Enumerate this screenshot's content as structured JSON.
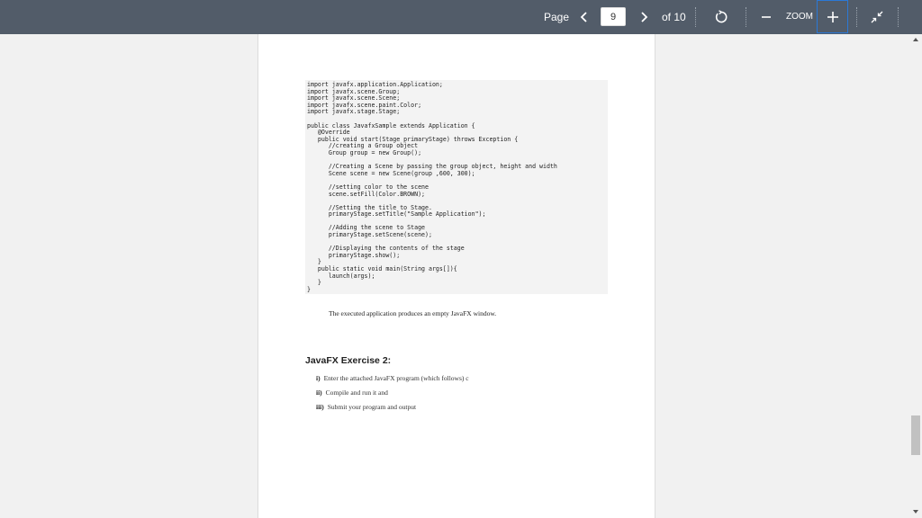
{
  "toolbar": {
    "page_label": "Page",
    "current_page": "9",
    "of_label": "of 10",
    "zoom_label": "ZOOM",
    "prev_icon": "chevron-left-icon",
    "next_icon": "chevron-right-icon",
    "rotate_icon": "rotate-icon",
    "zoom_out_icon": "minus-icon",
    "zoom_in_icon": "plus-icon",
    "exit_fullscreen_icon": "collapse-icon",
    "bg_color": "#525c69"
  },
  "document": {
    "code_lines": [
      "import javafx.application.Application;",
      "import javafx.scene.Group;",
      "import javafx.scene.Scene;",
      "import javafx.scene.paint.Color;",
      "import javafx.stage.Stage;",
      "",
      "public class JavafxSample extends Application {",
      "   @Override",
      "   public void start(Stage primaryStage) throws Exception {",
      "      //creating a Group object",
      "      Group group = new Group();",
      "",
      "      //Creating a Scene by passing the group object, height and width",
      "      Scene scene = new Scene(group ,600, 300);",
      "",
      "      //setting color to the scene",
      "      scene.setFill(Color.BROWN);",
      "",
      "      //Setting the title to Stage.",
      "      primaryStage.setTitle(\"Sample Application\");",
      "",
      "      //Adding the scene to Stage",
      "      primaryStage.setScene(scene);",
      "",
      "      //Displaying the contents of the stage",
      "      primaryStage.show();",
      "   }",
      "   public static void main(String args[]){",
      "      launch(args);",
      "   }",
      "}"
    ],
    "note": "The executed application produces an empty JavaFX window.",
    "exercise_title": "JavaFX Exercise 2:",
    "exercise_items": [
      {
        "num": "i)",
        "text": "Enter the attached JavaFX program (which follows) c"
      },
      {
        "num": "ii)",
        "text": "Compile and run it and"
      },
      {
        "num": "iii)",
        "text": "Submit your program and output"
      }
    ]
  }
}
